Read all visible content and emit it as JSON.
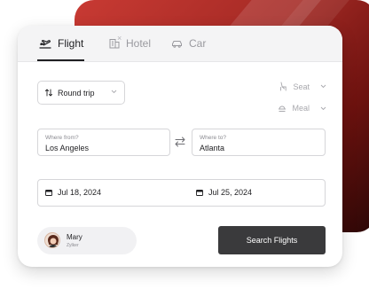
{
  "tabs": [
    {
      "label": "Flight",
      "icon": "plane-takeoff-icon",
      "active": true
    },
    {
      "label": "Hotel",
      "icon": "building-icon",
      "active": false
    },
    {
      "label": "Car",
      "icon": "car-icon",
      "active": false
    }
  ],
  "trip_type": {
    "selected": "Round trip",
    "icon": "swap-vertical-icon"
  },
  "options": {
    "seat": {
      "label": "Seat",
      "icon": "seat-icon"
    },
    "meal": {
      "label": "Meal",
      "icon": "meal-icon"
    }
  },
  "from": {
    "label": "Where from?",
    "value": "Los Angeles"
  },
  "to": {
    "label": "Where to?",
    "value": "Atlanta"
  },
  "swap_icon": "swap-horizontal-icon",
  "dates": {
    "depart": "Jul 18, 2024",
    "return": "Jul 25, 2024",
    "icon": "calendar-icon"
  },
  "traveler": {
    "name": "Mary",
    "subtitle": "Zylker",
    "remove": "×"
  },
  "search_button": "Search Flights",
  "colors": {
    "brand_gradient_start": "#c83a33",
    "brand_gradient_end": "#2a0706",
    "button": "#3a3a3c",
    "tab_active": "#1f1f22",
    "tab_inactive": "#9a9a9f"
  }
}
